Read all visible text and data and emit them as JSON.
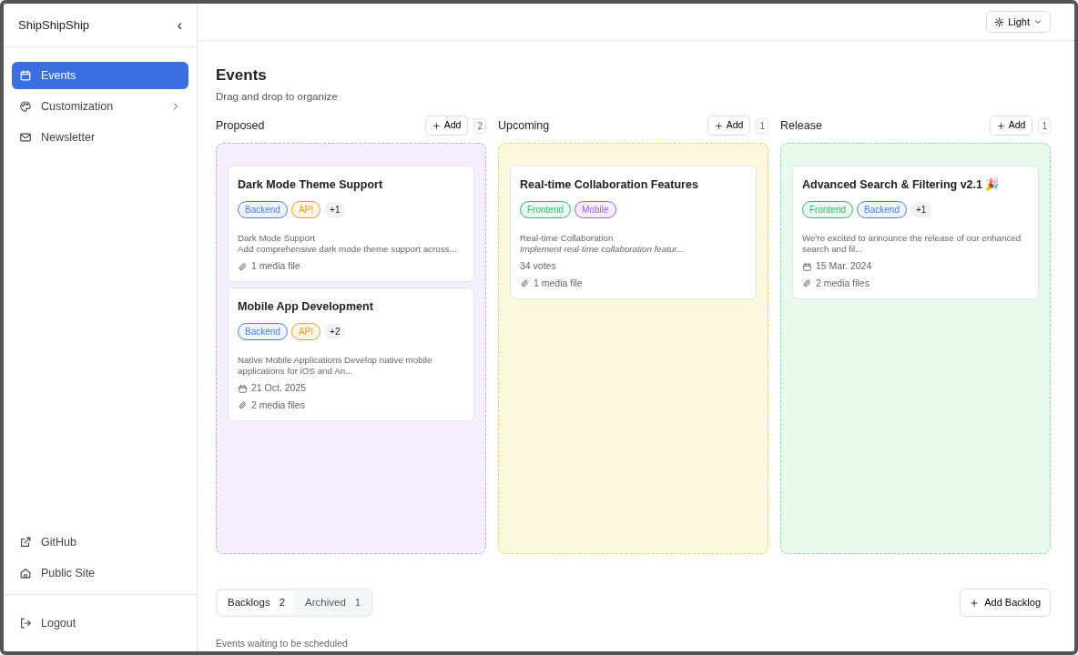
{
  "sidebar": {
    "brand": "ShipShipShip",
    "collapse_icon": "‹",
    "items": [
      {
        "label": "Events",
        "selected": true,
        "kind": "link"
      },
      {
        "label": "Customization",
        "selected": false,
        "kind": "submenu"
      },
      {
        "label": "Newsletter",
        "selected": false,
        "kind": "link"
      }
    ],
    "footer_items": [
      {
        "label": "GitHub"
      },
      {
        "label": "Public Site"
      }
    ],
    "logout": {
      "label": "Logout"
    }
  },
  "theme_toggle": {
    "label": "Light"
  },
  "page": {
    "title": "Events",
    "subtitle": "Drag and drop to organize"
  },
  "columns": [
    {
      "name": "Proposed",
      "add_label": "Add",
      "count": "2",
      "color": "#c4a8ec",
      "cards": [
        {
          "title": "Dark Mode Theme Support",
          "tags": [
            {
              "label": "Backend",
              "color": "#4a7fd8"
            },
            {
              "label": "API",
              "color": "#e0a020"
            }
          ],
          "more": "+1",
          "description": [
            "Dark Mode Support",
            "Add comprehensive dark mode theme support across..."
          ],
          "media": "1 media file"
        },
        {
          "title": "Mobile App Development",
          "tags": [
            {
              "label": "Backend",
              "color": "#4a7fd8"
            },
            {
              "label": "API",
              "color": "#e0a020"
            }
          ],
          "more": "+2",
          "description": [
            "Native Mobile Applications Develop native mobile applications for iOS and An..."
          ],
          "date": "21 Oct. 2025",
          "media": "2 media files"
        }
      ]
    },
    {
      "name": "Upcoming",
      "add_label": "Add",
      "count": "1",
      "color": "#e6d84a",
      "cards": [
        {
          "title": "Real-time Collaboration Features",
          "tags": [
            {
              "label": "Frontend",
              "color": "#2fb872"
            },
            {
              "label": "Mobile",
              "color": "#9b5de5"
            }
          ],
          "description": [
            "Real-time Collaboration",
            "*Implement real-time collaboration featur...*"
          ],
          "votes": "34 votes",
          "media": "1 media file"
        }
      ]
    },
    {
      "name": "Release",
      "add_label": "Add",
      "count": "1",
      "color": "#86dc9a",
      "cards": [
        {
          "title": "Advanced Search & Filtering v2.1 🎉",
          "tags": [
            {
              "label": "Frontend",
              "color": "#2fb872"
            },
            {
              "label": "Backend",
              "color": "#4a7fd8"
            }
          ],
          "more": "+1",
          "description": [
            "We're excited to announce the release of our enhanced search and fil..."
          ],
          "date": "15 Mar. 2024",
          "media": "2 media files"
        }
      ]
    }
  ],
  "backlog_tabs": [
    {
      "label": "Backlogs",
      "count": "2",
      "selected": true
    },
    {
      "label": "Archived",
      "count": "1",
      "selected": false
    }
  ],
  "add_backlog": "Add Backlog",
  "backlog_note": "Events waiting to be scheduled"
}
